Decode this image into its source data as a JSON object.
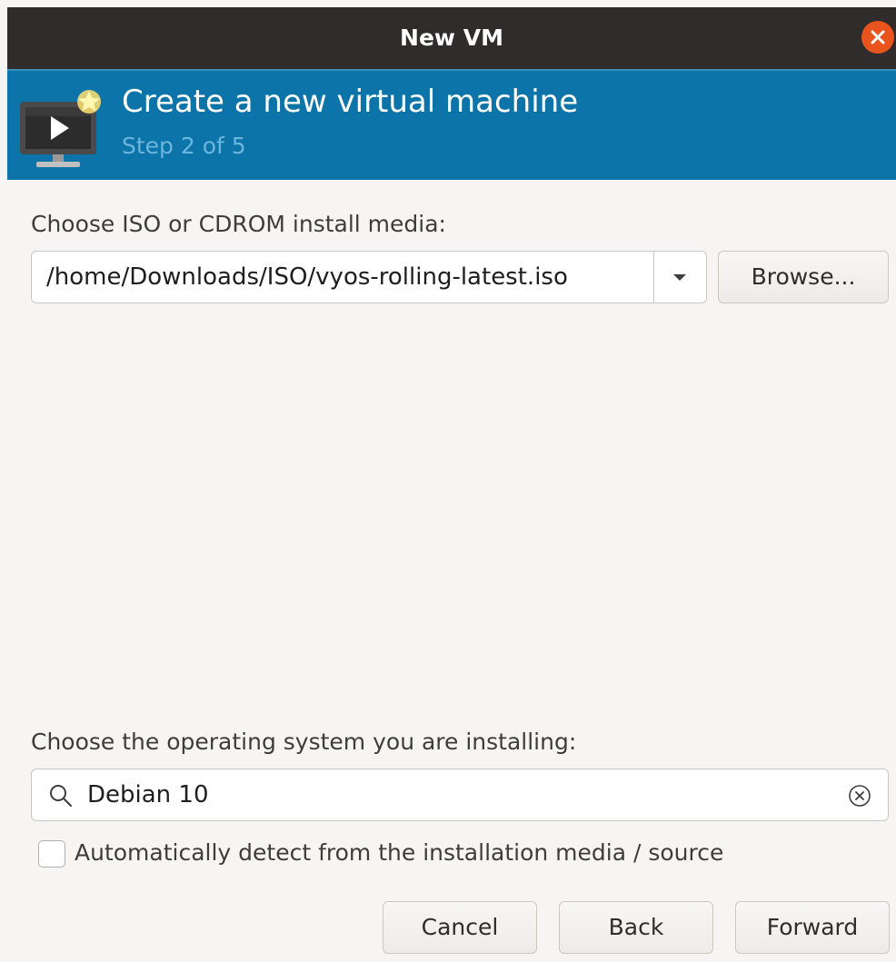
{
  "window": {
    "title": "New VM",
    "close_icon": "close-icon"
  },
  "header": {
    "title": "Create a new virtual machine",
    "step": "Step 2 of 5",
    "icon": "new-vm-monitor-icon",
    "accent_color": "#0c74a8"
  },
  "install_media": {
    "label": "Choose ISO or CDROM install media:",
    "value": "/home/Downloads/ISO/vyos-rolling-latest.iso",
    "dropdown_icon": "chevron-down-icon",
    "browse_label": "Browse..."
  },
  "os": {
    "label": "Choose the operating system you are installing:",
    "search_icon": "search-icon",
    "value": "Debian 10",
    "clear_icon": "clear-icon",
    "auto_detect_label": "Automatically detect from the installation media / source",
    "auto_detect_checked": false
  },
  "buttons": {
    "cancel": "Cancel",
    "back": "Back",
    "forward": "Forward"
  }
}
